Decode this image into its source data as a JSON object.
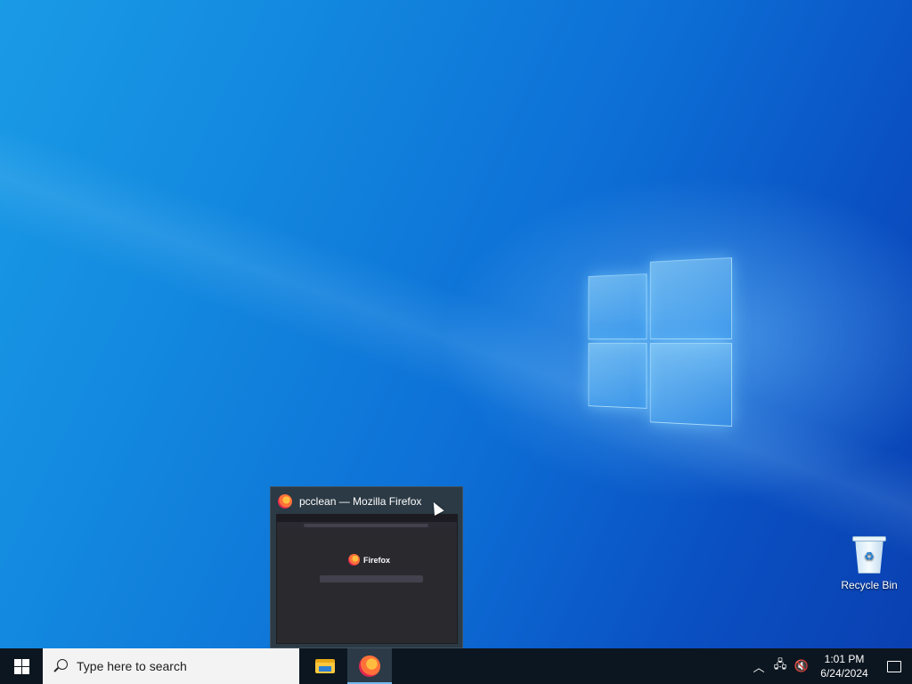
{
  "desktop": {
    "icons": [
      {
        "label": "Recycle Bin",
        "icon": "recycle-bin-icon"
      }
    ]
  },
  "thumbnail": {
    "title": "pcclean — Mozilla Firefox",
    "preview_brand": "Firefox"
  },
  "taskbar": {
    "search_placeholder": "Type here to search",
    "apps": [
      {
        "name": "File Explorer",
        "icon": "folder-icon"
      },
      {
        "name": "Firefox",
        "icon": "firefox-icon",
        "active": true
      }
    ],
    "clock": {
      "time": "1:01 PM",
      "date": "6/24/2024"
    }
  }
}
